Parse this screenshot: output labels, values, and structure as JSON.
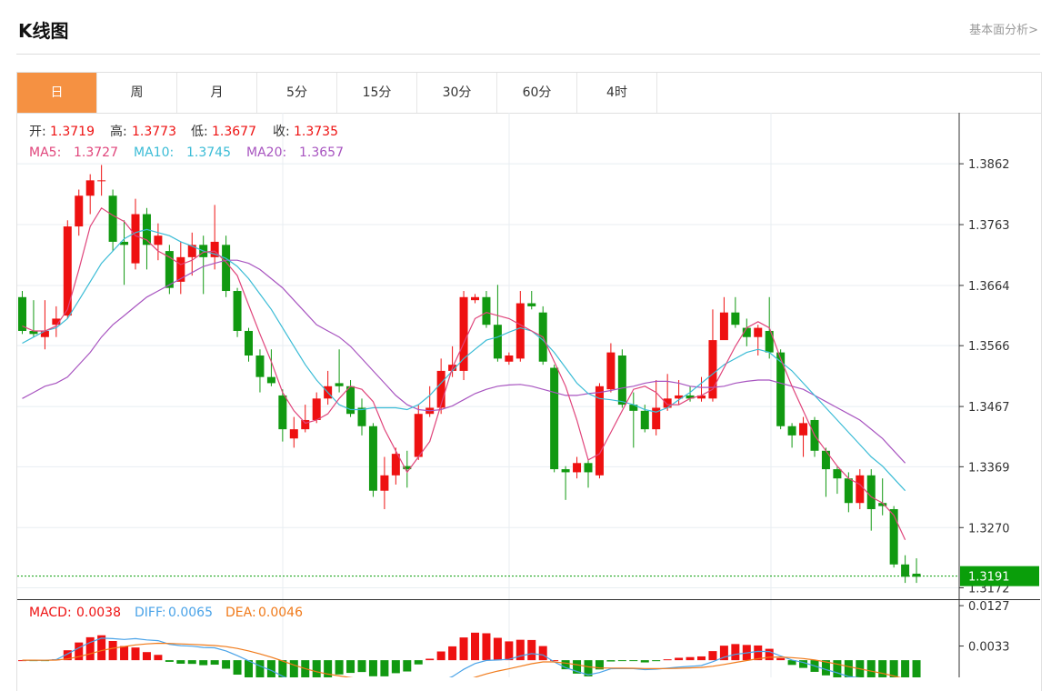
{
  "header": {
    "title": "K线图",
    "link": "基本面分析>"
  },
  "tabs": [
    {
      "label": "日",
      "active": true
    },
    {
      "label": "周",
      "active": false
    },
    {
      "label": "月",
      "active": false
    },
    {
      "label": "5分",
      "active": false
    },
    {
      "label": "15分",
      "active": false
    },
    {
      "label": "30分",
      "active": false
    },
    {
      "label": "60分",
      "active": false
    },
    {
      "label": "4时",
      "active": false
    }
  ],
  "info": {
    "open_label": "开:",
    "open": "1.3719",
    "high_label": "高:",
    "high": "1.3773",
    "low_label": "低:",
    "low": "1.3677",
    "close_label": "收:",
    "close": "1.3735",
    "ma5_label": "MA5:",
    "ma5": "1.3727",
    "ma10_label": "MA10:",
    "ma10": "1.3745",
    "ma20_label": "MA20:",
    "ma20": "1.3657"
  },
  "macd_info": {
    "macd_label": "MACD:",
    "macd": "0.0038",
    "diff_label": "DIFF:",
    "diff": "0.0065",
    "dea_label": "DEA:",
    "dea": "0.0046"
  },
  "colors": {
    "up": "#ee1111",
    "down": "#119911",
    "ma5": "#e0457b",
    "ma10": "#3bbcd6",
    "ma20": "#a855c0",
    "diff": "#4aa3e8",
    "dea": "#f07a1a",
    "last": "#0a9e0a",
    "tab_active": "#f59142"
  },
  "chart_data": {
    "type": "candlestick",
    "y_ticks": [
      "1.3862",
      "1.3763",
      "1.3664",
      "1.3566",
      "1.3467",
      "1.3369",
      "1.3270",
      "1.3172"
    ],
    "ylim": [
      1.3155,
      1.3945
    ],
    "last_price": "1.3191",
    "candles": [
      [
        1.3645,
        1.359,
        1.3655,
        1.3585
      ],
      [
        1.359,
        1.3585,
        1.364,
        1.358
      ],
      [
        1.358,
        1.359,
        1.364,
        1.356
      ],
      [
        1.36,
        1.361,
        1.363,
        1.358
      ],
      [
        1.3615,
        1.376,
        1.377,
        1.361
      ],
      [
        1.376,
        1.381,
        1.382,
        1.3745
      ],
      [
        1.381,
        1.3835,
        1.3845,
        1.378
      ],
      [
        1.3835,
        1.3835,
        1.386,
        1.381
      ],
      [
        1.381,
        1.3735,
        1.382,
        1.372
      ],
      [
        1.3735,
        1.373,
        1.377,
        1.3665
      ],
      [
        1.37,
        1.378,
        1.3805,
        1.369
      ],
      [
        1.378,
        1.373,
        1.379,
        1.369
      ],
      [
        1.373,
        1.3745,
        1.3765,
        1.3705
      ],
      [
        1.372,
        1.366,
        1.373,
        1.365
      ],
      [
        1.367,
        1.371,
        1.3735,
        1.365
      ],
      [
        1.371,
        1.373,
        1.375,
        1.368
      ],
      [
        1.373,
        1.371,
        1.3745,
        1.365
      ],
      [
        1.371,
        1.3735,
        1.3795,
        1.369
      ],
      [
        1.373,
        1.3655,
        1.3745,
        1.3645
      ],
      [
        1.3655,
        1.359,
        1.366,
        1.358
      ],
      [
        1.359,
        1.355,
        1.3595,
        1.354
      ],
      [
        1.355,
        1.3515,
        1.356,
        1.349
      ],
      [
        1.3515,
        1.3505,
        1.356,
        1.35
      ],
      [
        1.3485,
        1.343,
        1.3495,
        1.341
      ],
      [
        1.3415,
        1.343,
        1.345,
        1.34
      ],
      [
        1.343,
        1.3445,
        1.347,
        1.3425
      ],
      [
        1.3445,
        1.348,
        1.349,
        1.344
      ],
      [
        1.348,
        1.35,
        1.3525,
        1.347
      ],
      [
        1.3505,
        1.35,
        1.356,
        1.349
      ],
      [
        1.35,
        1.3455,
        1.351,
        1.345
      ],
      [
        1.3465,
        1.3435,
        1.348,
        1.342
      ],
      [
        1.3435,
        1.333,
        1.344,
        1.332
      ],
      [
        1.333,
        1.3355,
        1.3385,
        1.33
      ],
      [
        1.3355,
        1.339,
        1.34,
        1.334
      ],
      [
        1.337,
        1.3365,
        1.3395,
        1.3335
      ],
      [
        1.3385,
        1.3455,
        1.347,
        1.338
      ],
      [
        1.3455,
        1.3465,
        1.35,
        1.345
      ],
      [
        1.3465,
        1.3525,
        1.3545,
        1.3455
      ],
      [
        1.3525,
        1.3535,
        1.3565,
        1.3515
      ],
      [
        1.3525,
        1.3645,
        1.3655,
        1.351
      ],
      [
        1.364,
        1.3645,
        1.365,
        1.3635
      ],
      [
        1.3645,
        1.36,
        1.3655,
        1.3595
      ],
      [
        1.36,
        1.3545,
        1.3665,
        1.354
      ],
      [
        1.354,
        1.355,
        1.3555,
        1.3535
      ],
      [
        1.3545,
        1.3635,
        1.3655,
        1.354
      ],
      [
        1.3635,
        1.363,
        1.3655,
        1.3625
      ],
      [
        1.362,
        1.354,
        1.363,
        1.3535
      ],
      [
        1.353,
        1.3365,
        1.3535,
        1.336
      ],
      [
        1.3365,
        1.336,
        1.337,
        1.3315
      ],
      [
        1.336,
        1.3375,
        1.3385,
        1.335
      ],
      [
        1.3375,
        1.336,
        1.338,
        1.3335
      ],
      [
        1.3355,
        1.35,
        1.3505,
        1.335
      ],
      [
        1.3495,
        1.3555,
        1.357,
        1.349
      ],
      [
        1.355,
        1.347,
        1.356,
        1.3465
      ],
      [
        1.347,
        1.346,
        1.349,
        1.34
      ],
      [
        1.346,
        1.343,
        1.347,
        1.3425
      ],
      [
        1.343,
        1.3465,
        1.351,
        1.342
      ],
      [
        1.3465,
        1.348,
        1.352,
        1.346
      ],
      [
        1.348,
        1.3485,
        1.351,
        1.347
      ],
      [
        1.3485,
        1.348,
        1.35,
        1.3475
      ],
      [
        1.348,
        1.3485,
        1.3515,
        1.3475
      ],
      [
        1.348,
        1.3575,
        1.3625,
        1.3475
      ],
      [
        1.3575,
        1.362,
        1.3645,
        1.358
      ],
      [
        1.362,
        1.36,
        1.3645,
        1.3595
      ],
      [
        1.3595,
        1.358,
        1.361,
        1.3565
      ],
      [
        1.358,
        1.3595,
        1.36,
        1.355
      ],
      [
        1.359,
        1.3555,
        1.3645,
        1.3545
      ],
      [
        1.3555,
        1.3435,
        1.356,
        1.343
      ],
      [
        1.3435,
        1.342,
        1.344,
        1.34
      ],
      [
        1.342,
        1.344,
        1.345,
        1.3385
      ],
      [
        1.3445,
        1.3395,
        1.345,
        1.3385
      ],
      [
        1.3395,
        1.3365,
        1.34,
        1.332
      ],
      [
        1.3365,
        1.335,
        1.337,
        1.3325
      ],
      [
        1.335,
        1.331,
        1.336,
        1.3295
      ],
      [
        1.331,
        1.3355,
        1.3365,
        1.33
      ],
      [
        1.3355,
        1.33,
        1.3365,
        1.3265
      ],
      [
        1.331,
        1.3305,
        1.335,
        1.329
      ],
      [
        1.33,
        1.321,
        1.3305,
        1.3205
      ],
      [
        1.321,
        1.319,
        1.3225,
        1.318
      ],
      [
        1.3195,
        1.319,
        1.322,
        1.318
      ]
    ],
    "ma5": [
      1.3598,
      1.359,
      1.359,
      1.3598,
      1.3625,
      1.369,
      1.376,
      1.379,
      1.3778,
      1.3768,
      1.3745,
      1.3738,
      1.372,
      1.371,
      1.3698,
      1.3705,
      1.3718,
      1.372,
      1.3702,
      1.368,
      1.3632,
      1.3585,
      1.354,
      1.349,
      1.346,
      1.344,
      1.3445,
      1.3455,
      1.348,
      1.35,
      1.3495,
      1.3475,
      1.343,
      1.3395,
      1.336,
      1.3385,
      1.341,
      1.347,
      1.353,
      1.357,
      1.361,
      1.362,
      1.3615,
      1.361,
      1.36,
      1.359,
      1.358,
      1.354,
      1.35,
      1.3445,
      1.338,
      1.339,
      1.3425,
      1.346,
      1.3495,
      1.35,
      1.349,
      1.347,
      1.347,
      1.348,
      1.3485,
      1.3495,
      1.353,
      1.3565,
      1.3595,
      1.3605,
      1.3595,
      1.3545,
      1.35,
      1.346,
      1.342,
      1.3395,
      1.337,
      1.335,
      1.334,
      1.332,
      1.331,
      1.329,
      1.325
    ],
    "ma10": [
      1.357,
      1.358,
      1.359,
      1.3595,
      1.361,
      1.364,
      1.367,
      1.37,
      1.372,
      1.374,
      1.375,
      1.3755,
      1.375,
      1.3745,
      1.3735,
      1.3728,
      1.372,
      1.3715,
      1.3708,
      1.3695,
      1.3675,
      1.365,
      1.3625,
      1.3595,
      1.3565,
      1.3535,
      1.351,
      1.349,
      1.347,
      1.3462,
      1.3462,
      1.3465,
      1.3465,
      1.3465,
      1.3462,
      1.347,
      1.3485,
      1.3505,
      1.3525,
      1.3545,
      1.356,
      1.3575,
      1.358,
      1.3588,
      1.3595,
      1.359,
      1.3575,
      1.3555,
      1.353,
      1.3505,
      1.3488,
      1.348,
      1.3478,
      1.3475,
      1.347,
      1.3462,
      1.3458,
      1.3465,
      1.3478,
      1.349,
      1.3505,
      1.352,
      1.3535,
      1.3545,
      1.3555,
      1.356,
      1.3555,
      1.354,
      1.3525,
      1.3505,
      1.3485,
      1.3465,
      1.3445,
      1.3425,
      1.3405,
      1.3385,
      1.337,
      1.335,
      1.333
    ],
    "ma20": [
      1.348,
      1.349,
      1.35,
      1.3505,
      1.3515,
      1.3535,
      1.3555,
      1.358,
      1.36,
      1.3615,
      1.363,
      1.3645,
      1.3655,
      1.3665,
      1.3675,
      1.3685,
      1.3695,
      1.37,
      1.3705,
      1.3705,
      1.37,
      1.369,
      1.3675,
      1.366,
      1.364,
      1.362,
      1.36,
      1.359,
      1.358,
      1.3565,
      1.3545,
      1.3525,
      1.3505,
      1.3485,
      1.347,
      1.3462,
      1.346,
      1.3462,
      1.3468,
      1.3478,
      1.3488,
      1.3495,
      1.35,
      1.3502,
      1.3503,
      1.35,
      1.3495,
      1.349,
      1.3485,
      1.3485,
      1.3488,
      1.349,
      1.3493,
      1.3497,
      1.35,
      1.3505,
      1.3508,
      1.3508,
      1.3505,
      1.35,
      1.3498,
      1.3498,
      1.35,
      1.3505,
      1.3508,
      1.351,
      1.351,
      1.3505,
      1.35,
      1.3495,
      1.3485,
      1.3475,
      1.3465,
      1.3455,
      1.3445,
      1.343,
      1.3415,
      1.3395,
      1.3375
    ],
    "macd": {
      "y_ticks": [
        "0.0127",
        "0.0033"
      ],
      "ylim": [
        -0.004,
        0.014
      ]
    }
  }
}
